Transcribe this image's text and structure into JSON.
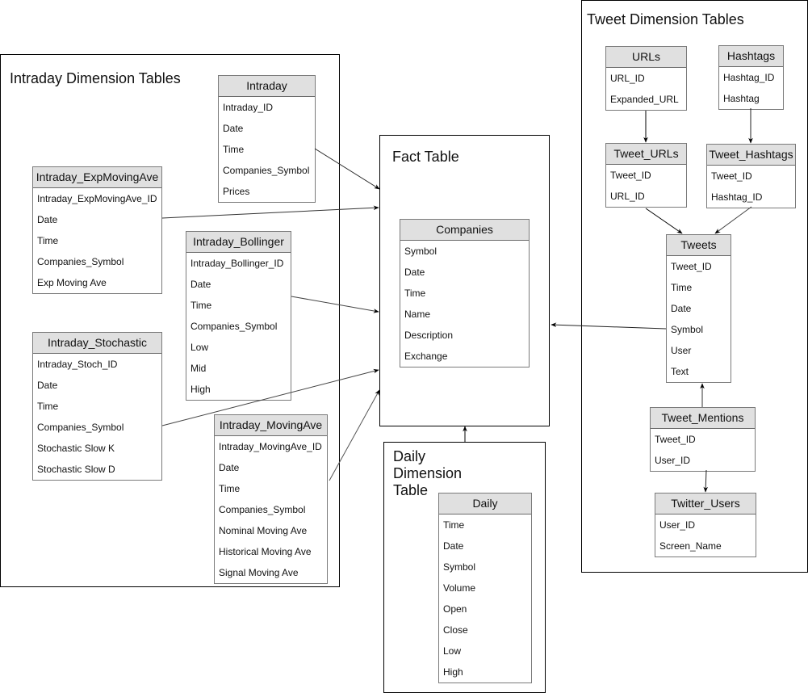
{
  "groups": {
    "intraday": {
      "title": "Intraday Dimension Tables"
    },
    "fact": {
      "title": "Fact Table"
    },
    "daily": {
      "title_lines": [
        "Daily",
        "Dimension",
        "Table"
      ]
    },
    "tweet": {
      "title": "Tweet Dimension Tables"
    }
  },
  "tables": {
    "intraday": {
      "name": "Intraday",
      "fields": [
        "Intraday_ID",
        "Date",
        "Time",
        "Companies_Symbol",
        "Prices"
      ]
    },
    "intraday_expmovingave": {
      "name": "Intraday_ExpMovingAve",
      "fields": [
        "Intraday_ExpMovingAve_ID",
        "Date",
        "Time",
        "Companies_Symbol",
        "Exp Moving Ave"
      ]
    },
    "intraday_bollinger": {
      "name": "Intraday_Bollinger",
      "fields": [
        "Intraday_Bollinger_ID",
        "Date",
        "Time",
        "Companies_Symbol",
        "Low",
        "Mid",
        "High"
      ]
    },
    "intraday_stochastic": {
      "name": "Intraday_Stochastic",
      "fields": [
        "Intraday_Stoch_ID",
        "Date",
        "Time",
        "Companies_Symbol",
        "Stochastic Slow K",
        "Stochastic Slow D"
      ]
    },
    "intraday_movingave": {
      "name": "Intraday_MovingAve",
      "fields": [
        "Intraday_MovingAve_ID",
        "Date",
        "Time",
        "Companies_Symbol",
        "Nominal Moving Ave",
        "Historical Moving Ave",
        "Signal Moving Ave"
      ]
    },
    "companies": {
      "name": "Companies",
      "fields": [
        "Symbol",
        "Date",
        "Time",
        "Name",
        "Description",
        "Exchange"
      ]
    },
    "daily": {
      "name": "Daily",
      "fields": [
        "Time",
        "Date",
        "Symbol",
        "Volume",
        "Open",
        "Close",
        "Low",
        "High"
      ]
    },
    "urls": {
      "name": "URLs",
      "fields": [
        "URL_ID",
        "Expanded_URL"
      ]
    },
    "hashtags": {
      "name": "Hashtags",
      "fields": [
        "Hashtag_ID",
        "Hashtag"
      ]
    },
    "tweet_urls": {
      "name": "Tweet_URLs",
      "fields": [
        "Tweet_ID",
        "URL_ID"
      ]
    },
    "tweet_hashtags": {
      "name": "Tweet_Hashtags",
      "fields": [
        "Tweet_ID",
        "Hashtag_ID"
      ]
    },
    "tweets": {
      "name": "Tweets",
      "fields": [
        "Tweet_ID",
        "Time",
        "Date",
        "Symbol",
        "User",
        "Text"
      ]
    },
    "tweet_mentions": {
      "name": "Tweet_Mentions",
      "fields": [
        "Tweet_ID",
        "User_ID"
      ]
    },
    "twitter_users": {
      "name": "Twitter_Users",
      "fields": [
        "User_ID",
        "Screen_Name"
      ]
    }
  },
  "relationships": [
    {
      "from": "Intraday",
      "to": "Fact Table"
    },
    {
      "from": "Intraday_ExpMovingAve",
      "to": "Fact Table"
    },
    {
      "from": "Intraday_Bollinger",
      "to": "Fact Table"
    },
    {
      "from": "Intraday_Stochastic",
      "to": "Fact Table"
    },
    {
      "from": "Intraday_MovingAve",
      "to": "Fact Table"
    },
    {
      "from": "Daily Dimension Table",
      "to": "Fact Table"
    },
    {
      "from": "Tweets",
      "to": "Fact Table"
    },
    {
      "from": "URLs",
      "to": "Tweet_URLs"
    },
    {
      "from": "Hashtags",
      "to": "Tweet_Hashtags"
    },
    {
      "from": "Tweet_URLs",
      "to": "Tweets"
    },
    {
      "from": "Tweet_Hashtags",
      "to": "Tweets"
    },
    {
      "from": "Tweet_Mentions",
      "to": "Tweets"
    },
    {
      "from": "Tweet_Mentions",
      "to": "Twitter_Users"
    }
  ]
}
